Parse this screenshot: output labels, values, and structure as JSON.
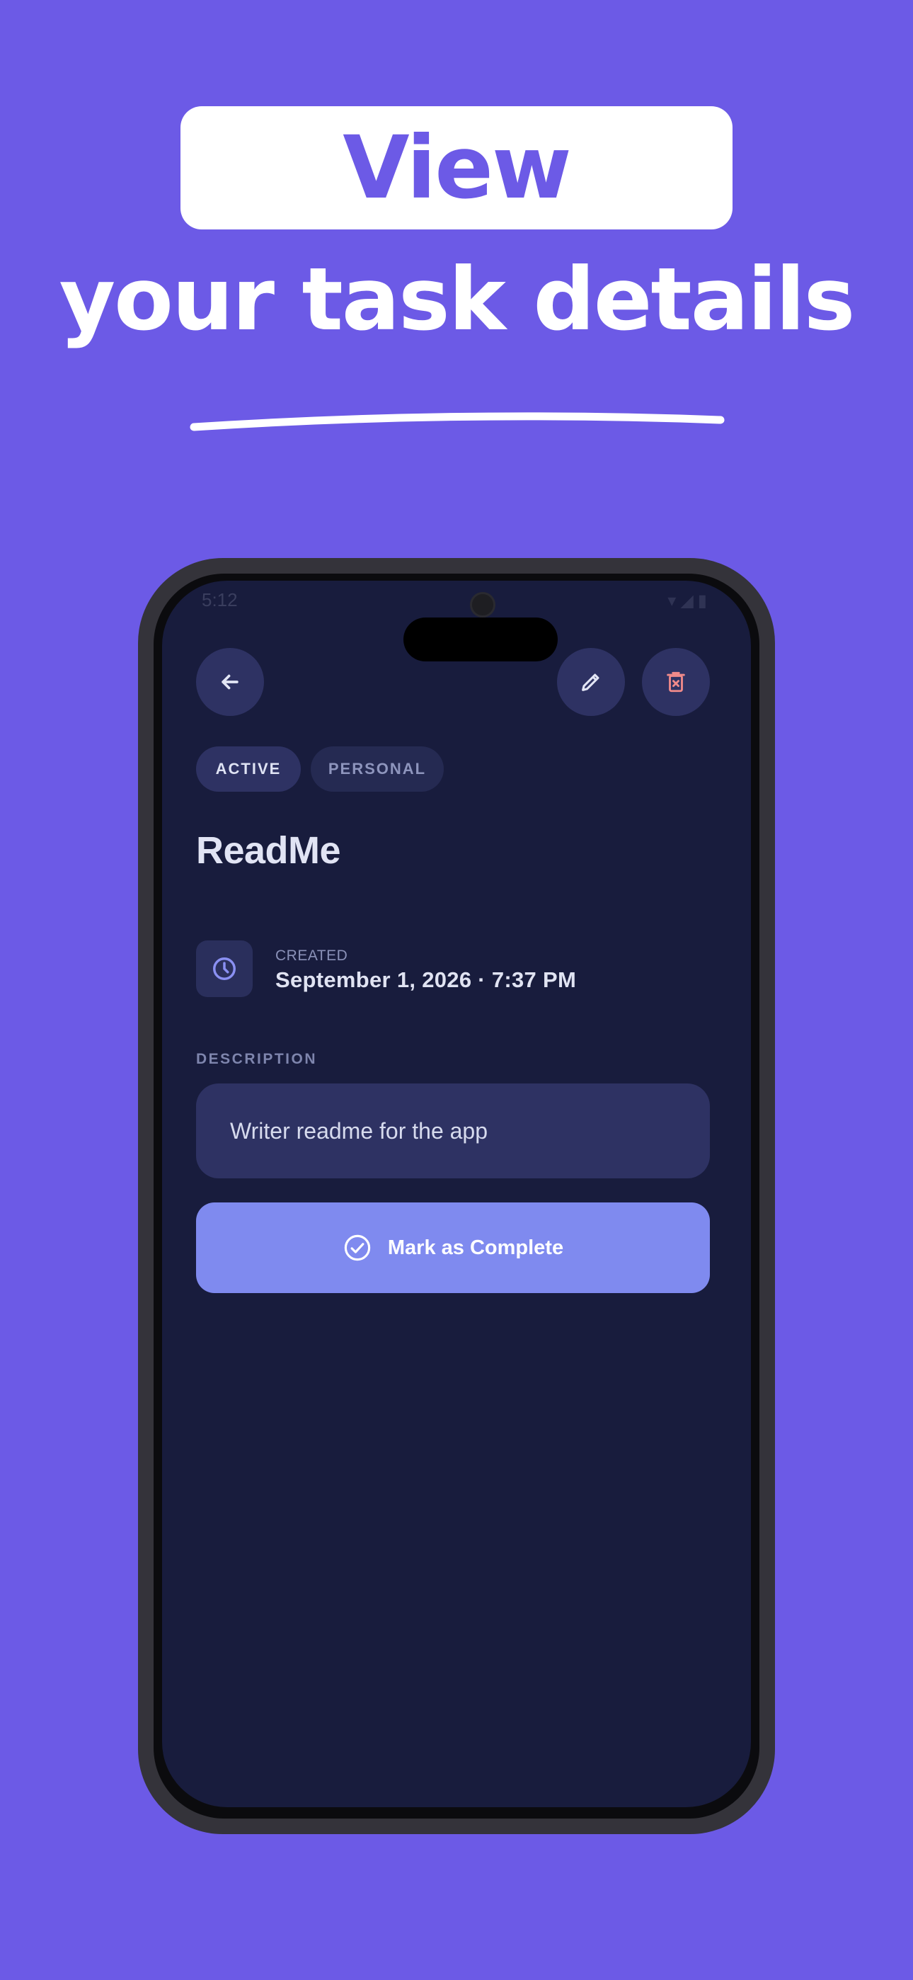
{
  "hero": {
    "title_highlight": "View",
    "title_rest": "your task details"
  },
  "status_bar": {
    "time": "5:12"
  },
  "header": {
    "back_icon": "arrow-left-icon",
    "edit_icon": "pencil-icon",
    "delete_icon": "trash-icon"
  },
  "task": {
    "status_chip": "ACTIVE",
    "category_chip": "PERSONAL",
    "title": "ReadMe",
    "created_label": "CREATED",
    "created_value": "September 1, 2026 · 7:37 PM",
    "description_label": "DESCRIPTION",
    "description": "Writer readme for the app",
    "complete_button_label": "Mark as Complete"
  },
  "colors": {
    "background": "#6c5ae6",
    "screen": "#181c3d",
    "surface": "#2e3263",
    "accent": "#7f8aef",
    "delete": "#f08a8a"
  }
}
